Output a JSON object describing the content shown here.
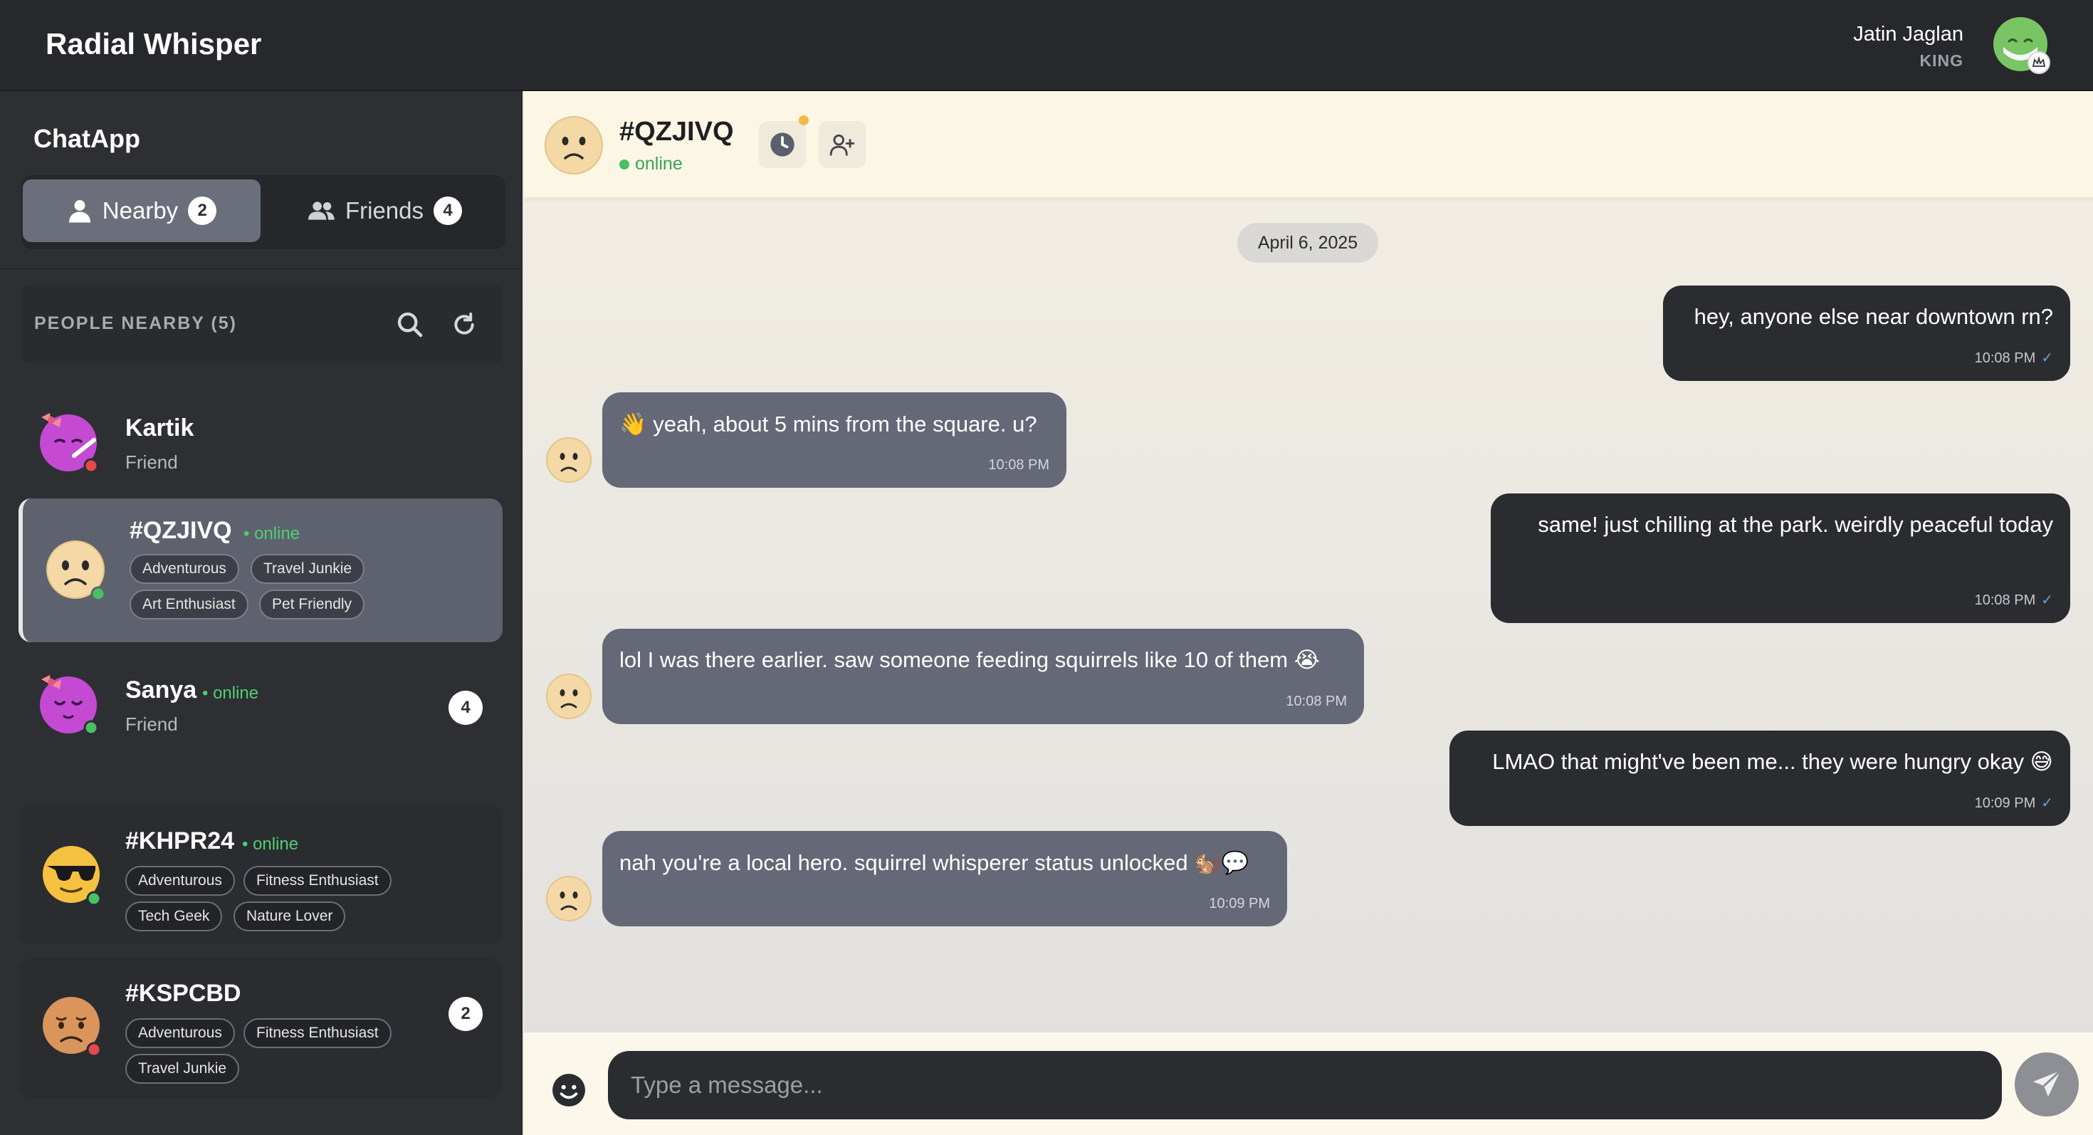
{
  "app": {
    "brand": "Radial Whisper"
  },
  "user": {
    "name": "Jatin Jaglan",
    "role": "KING"
  },
  "sidebar": {
    "title": "ChatApp",
    "tabs": [
      {
        "label": "Nearby",
        "count": "2"
      },
      {
        "label": "Friends",
        "count": "4"
      }
    ],
    "nearby_header": "PEOPLE NEARBY (5)",
    "people": [
      {
        "name": "Kartik",
        "subtitle": "Friend",
        "status_dot": "#e5484d"
      },
      {
        "name": "#QZJIVQ",
        "online": "• online",
        "tags": [
          "Adventurous",
          "Travel Junkie",
          "Art Enthusiast",
          "Pet Friendly"
        ],
        "status_dot": "#48c065"
      },
      {
        "name": "Sanya",
        "online": "• online",
        "subtitle": "Friend",
        "unread": "4",
        "status_dot": "#48c065"
      },
      {
        "name": "#KHPR24",
        "online": "• online",
        "tags": [
          "Adventurous",
          "Fitness Enthusiast",
          "Tech Geek",
          "Nature Lover"
        ],
        "status_dot": "#48c065"
      },
      {
        "name": "#KSPCBD",
        "tags": [
          "Adventurous",
          "Fitness Enthusiast",
          "Travel Junkie"
        ],
        "unread": "2",
        "status_dot": "#e5484d"
      }
    ]
  },
  "chat": {
    "name": "#QZJIVQ",
    "status": "online",
    "date": "April 6, 2025",
    "messages": [
      {
        "dir": "out",
        "text": "hey, anyone else near downtown rn?",
        "time": "10:08 PM",
        "tick": "✓"
      },
      {
        "dir": "in",
        "text": "👋 yeah, about 5 mins from the square. u?",
        "time": "10:08 PM"
      },
      {
        "dir": "out",
        "text": "same! just chilling at the park. weirdly peaceful today",
        "time": "10:08 PM",
        "tick": "✓"
      },
      {
        "dir": "in",
        "text": "lol I was there earlier. saw someone feeding squirrels like 10 of them 😭",
        "time": "10:08 PM"
      },
      {
        "dir": "out",
        "text": "LMAO that might've been me... they were hungry okay 😅",
        "time": "10:09 PM",
        "tick": "✓"
      },
      {
        "dir": "in",
        "text": "nah you're a local hero. squirrel whisperer status unlocked 🐿️💬",
        "time": "10:09 PM"
      }
    ]
  },
  "composer": {
    "placeholder": "Type a message..."
  },
  "colors": {
    "online": "#48c065",
    "offline": "#e5484d",
    "accent_dark": "#2b2c30",
    "incoming": "#646877"
  },
  "icons": [
    "user-icon",
    "users-icon",
    "search-icon",
    "refresh-icon",
    "clock-icon",
    "user-plus-icon",
    "smiley-icon",
    "send-icon",
    "crown-icon"
  ]
}
